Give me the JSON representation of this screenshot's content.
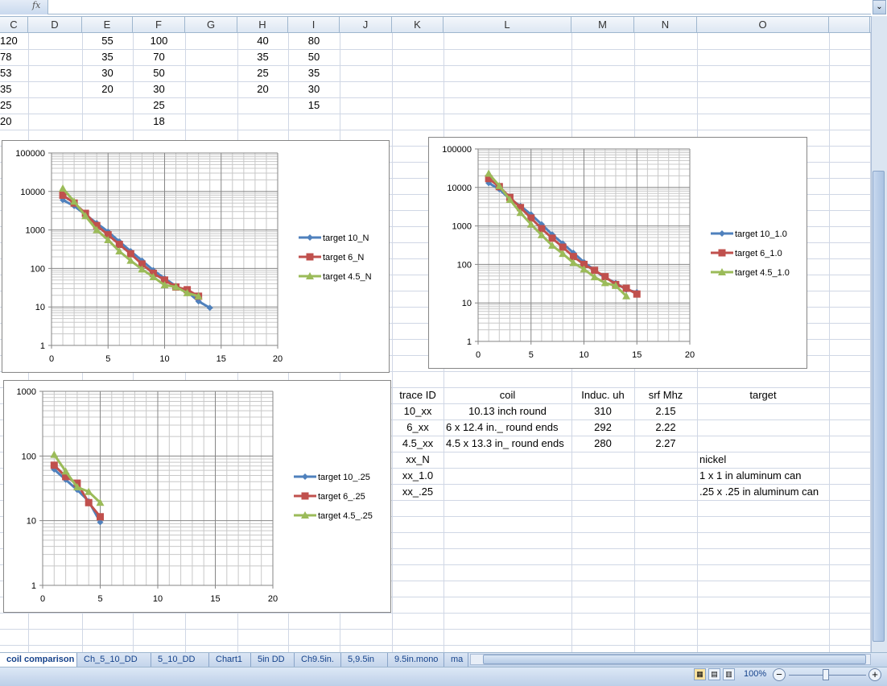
{
  "formula_bar": {
    "fx_label": "fx",
    "expand_icon": "double-chevron-down-icon"
  },
  "columns": [
    "C",
    "D",
    "E",
    "F",
    "G",
    "H",
    "I",
    "J",
    "K",
    "L",
    "M",
    "N",
    "O"
  ],
  "top_data": {
    "C": [
      "120",
      "78",
      "53",
      "35",
      "25",
      "20"
    ],
    "E": [
      "55",
      "35",
      "30",
      "20"
    ],
    "F": [
      "100",
      "70",
      "50",
      "30",
      "25",
      "18"
    ],
    "H": [
      "40",
      "35",
      "25",
      "20"
    ],
    "I": [
      "80",
      "50",
      "35",
      "30",
      "15"
    ]
  },
  "table": {
    "headers": [
      "trace ID",
      "coil",
      "Induc. uh",
      "srf Mhz",
      "target"
    ],
    "rows": [
      [
        "10_xx",
        "10.13 inch round",
        "310",
        "2.15",
        ""
      ],
      [
        "6_xx",
        "6 x 12.4 in._ round ends",
        "292",
        "2.22",
        ""
      ],
      [
        "4.5_xx",
        "4.5 x 13.3 in_ round ends",
        "280",
        "2.27",
        ""
      ],
      [
        "xx_N",
        "",
        "",
        "",
        "nickel"
      ],
      [
        "xx_1.0",
        "",
        "",
        "",
        "1 x 1 in aluminum can"
      ],
      [
        "xx_.25",
        "",
        "",
        "",
        ".25 x .25 in aluminum can"
      ]
    ]
  },
  "series_colors": [
    "#4f81bd",
    "#c0504d",
    "#9bbb59"
  ],
  "chart_data": [
    {
      "type": "line",
      "yscale": "log",
      "xlim": [
        0,
        20
      ],
      "ylim": [
        1,
        100000
      ],
      "grid": true,
      "legend": "right",
      "xticks": [
        "0",
        "5",
        "10",
        "15",
        "20"
      ],
      "yticks": [
        "1",
        "10",
        "100",
        "1000",
        "10000",
        "100000"
      ],
      "series": [
        {
          "name": "target 10_N",
          "marker": "diamond",
          "x": [
            1,
            2,
            3,
            4,
            5,
            6,
            7,
            8,
            9,
            10,
            11,
            12,
            13,
            14
          ],
          "y": [
            6000,
            4200,
            2500,
            1500,
            900,
            500,
            280,
            160,
            90,
            55,
            35,
            25,
            14,
            9.5
          ]
        },
        {
          "name": "target 6_N",
          "marker": "square",
          "x": [
            1,
            2,
            3,
            4,
            5,
            6,
            7,
            8,
            9,
            10,
            11,
            12,
            13
          ],
          "y": [
            8000,
            5000,
            2700,
            1300,
            750,
            420,
            240,
            130,
            75,
            50,
            33,
            28,
            19
          ]
        },
        {
          "name": "target 4.5_N",
          "marker": "triangle",
          "x": [
            1,
            2,
            3,
            4,
            5,
            6,
            7,
            8,
            9,
            10,
            11,
            12,
            13
          ],
          "y": [
            12000,
            5500,
            2300,
            1000,
            550,
            280,
            160,
            95,
            60,
            37,
            33,
            23,
            19
          ]
        }
      ]
    },
    {
      "type": "line",
      "yscale": "log",
      "xlim": [
        0,
        20
      ],
      "ylim": [
        1,
        100000
      ],
      "grid": true,
      "legend": "right",
      "xticks": [
        "0",
        "5",
        "10",
        "15",
        "20"
      ],
      "yticks": [
        "1",
        "10",
        "100",
        "1000",
        "10000",
        "100000"
      ],
      "series": [
        {
          "name": "target 10_1.0",
          "marker": "diamond",
          "x": [
            1,
            2,
            3,
            4,
            5,
            6,
            7,
            8,
            9,
            10,
            11,
            12,
            13,
            14,
            15
          ],
          "y": [
            13000,
            9000,
            5000,
            3300,
            2000,
            1100,
            600,
            350,
            200,
            115,
            70,
            45,
            33,
            22,
            19
          ]
        },
        {
          "name": "target 6_1.0",
          "marker": "square",
          "x": [
            1,
            2,
            3,
            4,
            5,
            6,
            7,
            8,
            9,
            10,
            11,
            12,
            13,
            14,
            15
          ],
          "y": [
            17000,
            10500,
            5500,
            3000,
            1600,
            850,
            480,
            280,
            160,
            100,
            70,
            48,
            30,
            24,
            17
          ]
        },
        {
          "name": "target 4.5_1.0",
          "marker": "triangle",
          "x": [
            1,
            2,
            3,
            4,
            5,
            6,
            7,
            8,
            9,
            10,
            11,
            12,
            13,
            14
          ],
          "y": [
            23000,
            11000,
            4800,
            2200,
            1100,
            580,
            310,
            190,
            110,
            75,
            47,
            33,
            28,
            15
          ]
        }
      ]
    },
    {
      "type": "line",
      "yscale": "log",
      "xlim": [
        0,
        20
      ],
      "ylim": [
        1,
        1000
      ],
      "grid": true,
      "legend": "right",
      "xticks": [
        "0",
        "5",
        "10",
        "15",
        "20"
      ],
      "yticks": [
        "1",
        "10",
        "100",
        "1000"
      ],
      "series": [
        {
          "name": "target 10_.25",
          "marker": "diamond",
          "x": [
            1,
            2,
            3,
            4,
            5
          ],
          "y": [
            62,
            43,
            30,
            20,
            9.5
          ]
        },
        {
          "name": "target 6_.25",
          "marker": "square",
          "x": [
            1,
            2,
            3,
            4,
            5
          ],
          "y": [
            72,
            48,
            38,
            19,
            11.5
          ]
        },
        {
          "name": "target 4.5_.25",
          "marker": "triangle",
          "x": [
            1,
            2,
            3,
            4,
            5
          ],
          "y": [
            105,
            58,
            33,
            28,
            19
          ]
        }
      ]
    }
  ],
  "sheet_tabs": [
    "coil comparison",
    "Ch_5_10_DD",
    "5_10_DD",
    "Chart1",
    "5in DD",
    "Ch9.5in.",
    "5,9.5in",
    "9.5in.mono",
    "ma"
  ],
  "active_tab": "coil comparison",
  "status": {
    "zoom": "100%",
    "zoom_level_percent": 100
  }
}
